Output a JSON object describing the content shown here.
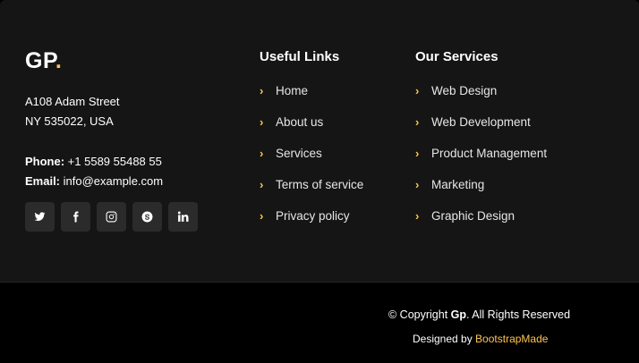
{
  "brand": {
    "name": "GP",
    "dot": "."
  },
  "address": {
    "line1": "A108 Adam Street",
    "line2": "NY 535022, USA"
  },
  "contact": {
    "phone_label": "Phone:",
    "phone": " +1 5589 55488 55",
    "email_label": "Email:",
    "email": " info@example.com"
  },
  "social": [
    "twitter-icon",
    "facebook-icon",
    "instagram-icon",
    "skype-icon",
    "linkedin-icon"
  ],
  "useful_links": {
    "title": "Useful Links",
    "items": [
      "Home",
      "About us",
      "Services",
      "Terms of service",
      "Privacy policy"
    ]
  },
  "services": {
    "title": "Our Services",
    "items": [
      "Web Design",
      "Web Development",
      "Product Management",
      "Marketing",
      "Graphic Design"
    ]
  },
  "copyright": {
    "prefix": "© Copyright ",
    "brand": "Gp",
    "suffix": ". All Rights Reserved",
    "designed_by": "Designed by ",
    "designer": "BootstrapMade"
  },
  "colors": {
    "accent": "#ffc451",
    "top_bg": "#151515",
    "bottom_bg": "#000000"
  }
}
